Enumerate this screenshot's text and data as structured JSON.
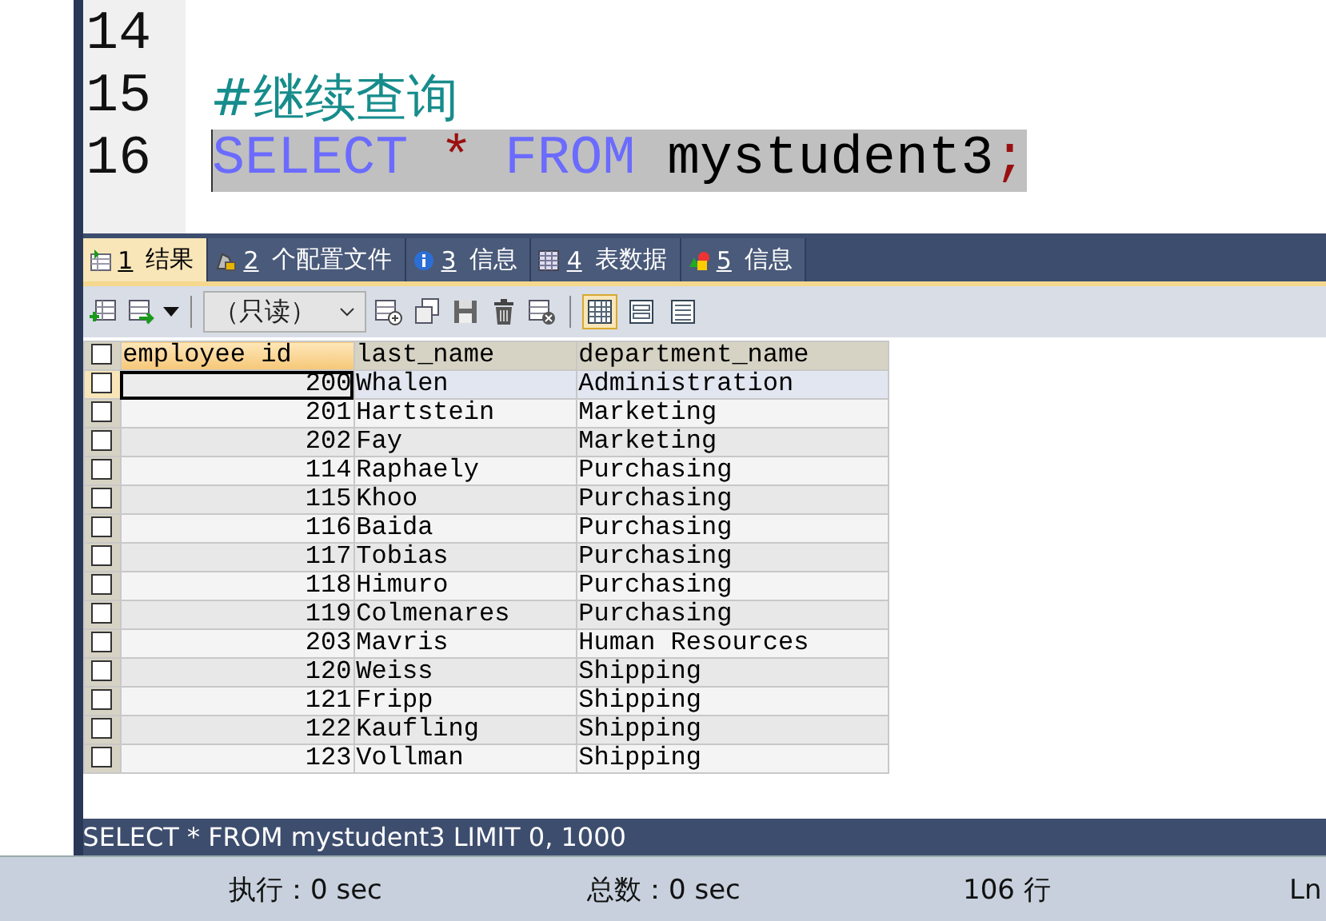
{
  "editor": {
    "lines": [
      {
        "number": "14"
      },
      {
        "number": "15",
        "tokens": [
          {
            "kind": "comment",
            "text": "#继续查询"
          }
        ]
      },
      {
        "number": "16",
        "selected": true,
        "tokens": [
          {
            "kind": "keyword",
            "text": "SELECT"
          },
          {
            "kind": "operator",
            "text": "*"
          },
          {
            "kind": "keyword",
            "text": "FROM"
          },
          {
            "kind": "identifier",
            "text": "mystudent3"
          },
          {
            "kind": "punct",
            "text": ";"
          }
        ]
      }
    ]
  },
  "result_tabs": [
    {
      "number": "1",
      "label": "结果",
      "selected": true,
      "kind": "grid"
    },
    {
      "number": "2",
      "label": "个配置文件",
      "selected": false,
      "kind": "profile"
    },
    {
      "number": "3",
      "label": "信息",
      "selected": false,
      "kind": "info"
    },
    {
      "number": "4",
      "label": "表数据",
      "selected": false,
      "kind": "table"
    },
    {
      "number": "5",
      "label": "信息",
      "selected": false,
      "kind": "shapes"
    }
  ],
  "toolbar": {
    "mode_dropdown": "（只读）",
    "views": [
      {
        "kind": "grid",
        "selected": true
      },
      {
        "kind": "form",
        "selected": false
      },
      {
        "kind": "text",
        "selected": false
      }
    ]
  },
  "table": {
    "select_all_checked": false,
    "columns": [
      {
        "label": "employee id",
        "selected": true
      },
      {
        "label": "last_name",
        "selected": false
      },
      {
        "label": "department_name",
        "selected": false
      }
    ],
    "rows": [
      {
        "cells": [
          "200",
          "Whalen",
          "Administration"
        ],
        "selected": true,
        "checked": false
      },
      {
        "cells": [
          "201",
          "Hartstein",
          "Marketing"
        ],
        "selected": false,
        "checked": false
      },
      {
        "cells": [
          "202",
          "Fay",
          "Marketing"
        ],
        "selected": false,
        "checked": false
      },
      {
        "cells": [
          "114",
          "Raphaely",
          "Purchasing"
        ],
        "selected": false,
        "checked": false
      },
      {
        "cells": [
          "115",
          "Khoo",
          "Purchasing"
        ],
        "selected": false,
        "checked": false
      },
      {
        "cells": [
          "116",
          "Baida",
          "Purchasing"
        ],
        "selected": false,
        "checked": false
      },
      {
        "cells": [
          "117",
          "Tobias",
          "Purchasing"
        ],
        "selected": false,
        "checked": false
      },
      {
        "cells": [
          "118",
          "Himuro",
          "Purchasing"
        ],
        "selected": false,
        "checked": false
      },
      {
        "cells": [
          "119",
          "Colmenares",
          "Purchasing"
        ],
        "selected": false,
        "checked": false
      },
      {
        "cells": [
          "203",
          "Mavris",
          "Human Resources"
        ],
        "selected": false,
        "checked": false
      },
      {
        "cells": [
          "120",
          "Weiss",
          "Shipping"
        ],
        "selected": false,
        "checked": false
      },
      {
        "cells": [
          "121",
          "Fripp",
          "Shipping"
        ],
        "selected": false,
        "checked": false
      },
      {
        "cells": [
          "122",
          "Kaufling",
          "Shipping"
        ],
        "selected": false,
        "checked": false
      },
      {
        "cells": [
          "123",
          "Vollman",
          "Shipping"
        ],
        "selected": false,
        "checked": false
      }
    ]
  },
  "query_bar": "SELECT * FROM mystudent3 LIMIT 0, 1000",
  "status_bar": {
    "exec_time": "执行：0 sec",
    "total_time": "总数：0 sec",
    "rows": "106 行",
    "position": "Ln"
  }
}
